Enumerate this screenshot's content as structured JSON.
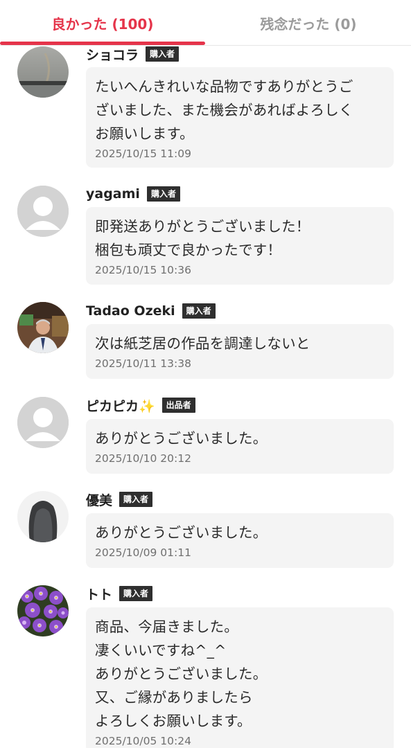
{
  "tabs": {
    "good_label": "良かった (100)",
    "bad_label": "残念だった (0)",
    "active_color": "#e5344a",
    "inactive_color": "#9b9b9b"
  },
  "reviews": [
    {
      "username": "ショコラ",
      "role": "購入者",
      "avatar": "landscape-photo",
      "message": "たいへんきれいな品物ですありがとうご\nざいました、また機会があればよろしく\nお願いします。",
      "date": "2025/10/15 11:09"
    },
    {
      "username": "yagami",
      "role": "購入者",
      "avatar": "default-user-icon",
      "message": "即発送ありがとうございました！\n梱包も頑丈で良かったです！",
      "date": "2025/10/15 10:36"
    },
    {
      "username": "Tadao  Ozeki",
      "role": "購入者",
      "avatar": "person-photo",
      "message": "次は紙芝居の作品を調達しないと",
      "date": "2025/10/11 13:38"
    },
    {
      "username": "ピカピカ✨",
      "role": "出品者",
      "avatar": "default-user-icon",
      "message": "ありがとうございました。",
      "date": "2025/10/10 20:12"
    },
    {
      "username": "優美",
      "role": "購入者",
      "avatar": "hair-photo",
      "message": "ありがとうございました。",
      "date": "2025/10/09 01:11"
    },
    {
      "username": "トト",
      "role": "購入者",
      "avatar": "flowers-photo",
      "message": "商品、今届きました。\n凄くいいですね^_^\nありがとうございました。\n又、ご縁がありましたら\nよろしくお願いします。",
      "date": "2025/10/05 10:24"
    }
  ]
}
